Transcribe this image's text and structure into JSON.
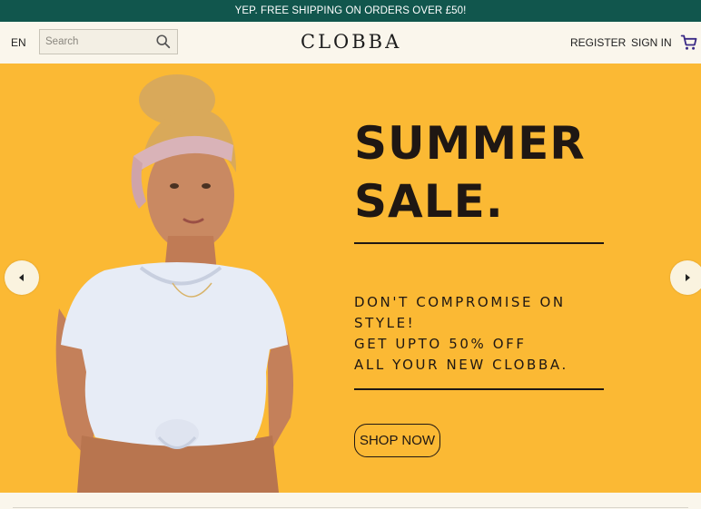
{
  "promo": {
    "text": "YEP. FREE SHIPPING ON ORDERS OVER £50!"
  },
  "header": {
    "language": "EN",
    "search_placeholder": "Search",
    "logo": "CLOBBA",
    "register": "REGISTER",
    "sign_in": "SIGN IN",
    "icons": {
      "search": "search-icon",
      "cart": "cart-icon"
    }
  },
  "hero": {
    "headline_1": "SUMMER",
    "headline_2": "SALE.",
    "tagline_1": "DON'T COMPROMISE ON",
    "tagline_2": "STYLE!",
    "tagline_3": "GET UPTO 50% OFF",
    "tagline_4": "ALL YOUR NEW CLOBBA.",
    "cta": "SHOP NOW",
    "prev_icon": "caret-left-icon",
    "next_icon": "caret-right-icon"
  },
  "colors": {
    "promo_bg": "#11564d",
    "header_bg": "#faf6ec",
    "hero_bg": "#fbb934",
    "text_dark": "#1f1713",
    "cart_accent": "#3b2a86"
  }
}
